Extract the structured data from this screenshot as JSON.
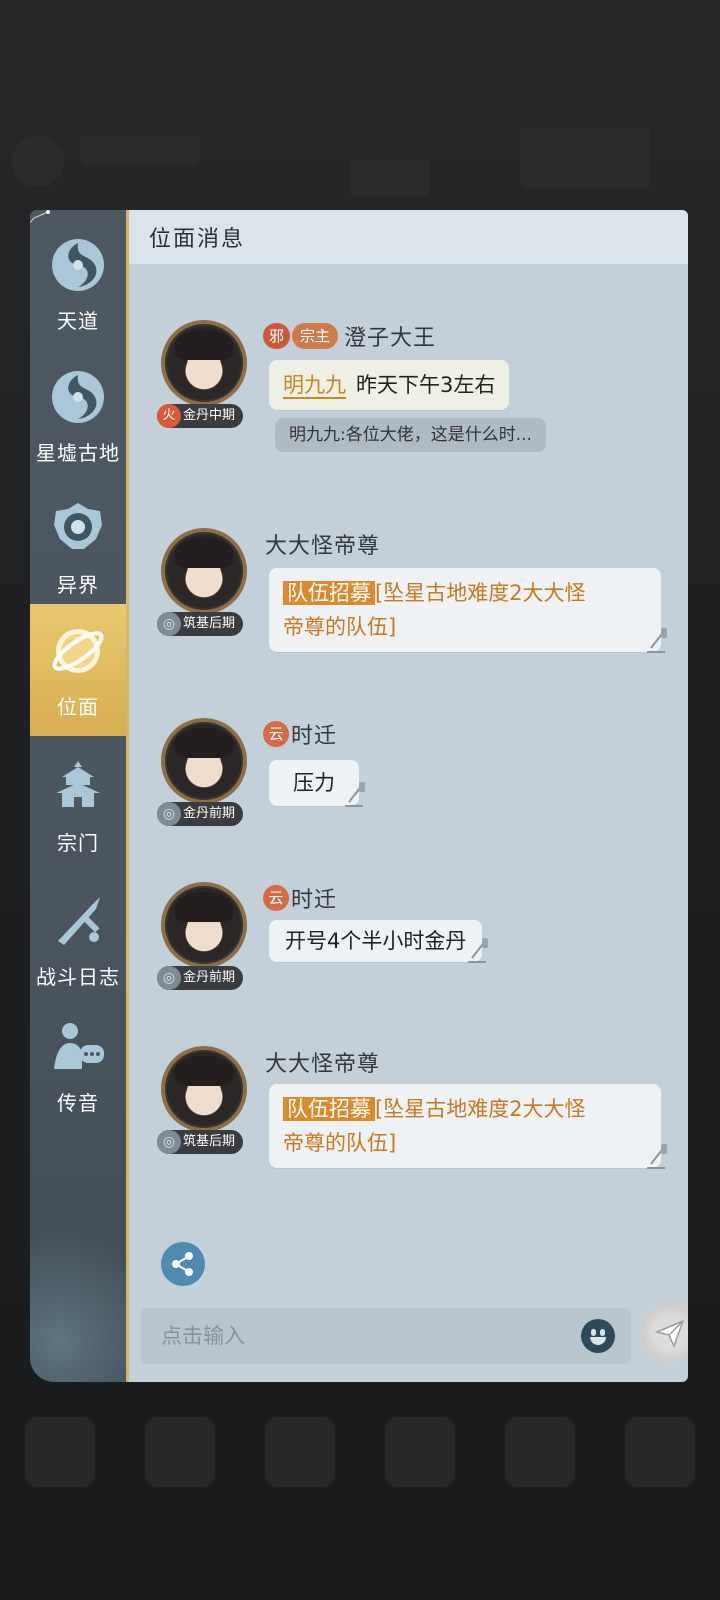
{
  "header": {
    "title": "位面消息"
  },
  "sidebar": {
    "items": [
      {
        "label": "天道",
        "icon": "swirl-icon",
        "active": false
      },
      {
        "label": "星墟古地",
        "icon": "swirl-icon",
        "active": false
      },
      {
        "label": "异界",
        "icon": "portal-icon",
        "active": false
      },
      {
        "label": "位面",
        "icon": "planet-icon",
        "active": true
      },
      {
        "label": "宗门",
        "icon": "pagoda-icon",
        "active": false
      },
      {
        "label": "战斗日志",
        "icon": "sword-icon",
        "active": false
      },
      {
        "label": "传音",
        "icon": "speaking-person-icon",
        "active": false
      }
    ]
  },
  "messages": [
    {
      "faction_tag": "邪",
      "role_tag": "宗主",
      "sender": "澄子大王",
      "rank": "金丹中期",
      "rank_icon": "火",
      "reply_to": "明九九",
      "text": "昨天下午3左右",
      "quote_preview": "明九九:各位大佬，这是什么时..."
    },
    {
      "sender": "大大怪帝尊",
      "rank": "筑基后期",
      "team_tag": "队伍招募",
      "team_line1": "[坠星古地难度2大大怪",
      "team_line2": "帝尊的队伍]"
    },
    {
      "faction_tag": "云",
      "sender": "时迁",
      "rank": "金丹前期",
      "text": "压力"
    },
    {
      "faction_tag": "云",
      "sender": "时迁",
      "rank": "金丹前期",
      "text": "开号4个半小时金丹"
    },
    {
      "sender": "大大怪帝尊",
      "rank": "筑基后期",
      "team_tag": "队伍招募",
      "team_line1": "[坠星古地难度2大大怪",
      "team_line2": "帝尊的队伍]"
    }
  ],
  "input": {
    "placeholder": "点击输入"
  },
  "colors": {
    "accent_gold": "#d8ae53",
    "team_orange": "#dc8a2e",
    "panel_bg": "#c4d0d9",
    "sidebar_bg": "#4d5862"
  }
}
